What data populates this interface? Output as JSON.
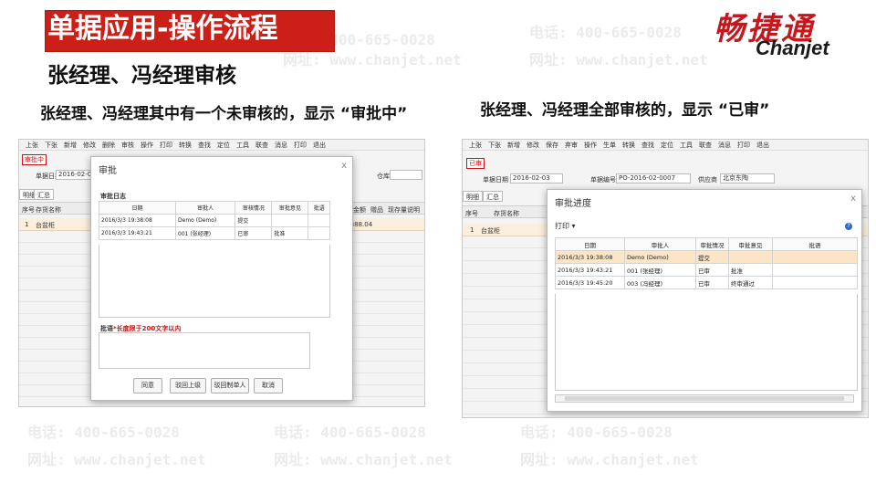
{
  "header": {
    "title": "单据应用-操作流程",
    "subtitle": "张经理、冯经理审核",
    "logo_cn": "畅捷通",
    "logo_en": "Chanjet"
  },
  "captions": {
    "left": "张经理、冯经理其中有一个未审核的，显示 “审批中”",
    "right": "张经理、冯经理全部审核的，显示 “已审”"
  },
  "watermark": {
    "phone": "电话: 400-665-0028",
    "site": "网址: www.chanjet.net"
  },
  "left_panel": {
    "menu": [
      "上张",
      "下张",
      "新增",
      "修改",
      "删除",
      "审核",
      "操作",
      "打印",
      "转换",
      "查找",
      "定位",
      "工具",
      "联查",
      "消息",
      "打印",
      "退出"
    ],
    "status_tag": "审批中",
    "date_label": "单据日期",
    "date_value": "2016-02-03",
    "warehouse_label": "仓库",
    "tabs": [
      "明细",
      "汇总"
    ],
    "grid_headers": [
      "序号",
      "存货名称",
      "含税金额",
      "赠品",
      "现存量说明"
    ],
    "row": {
      "index": "1",
      "name": "台盆柜",
      "amount": "1,888.04"
    },
    "dialog": {
      "title": "审批",
      "close": "x",
      "section": "审批日志",
      "headers": [
        "日期",
        "审批人",
        "审核情况",
        "审批意见",
        "批语"
      ],
      "rows": [
        {
          "date": "2016/3/3 19:38:08",
          "person": "Demo (Demo)",
          "status": "提交",
          "opinion": "",
          "comment": ""
        },
        {
          "date": "2016/3/3 19:43:21",
          "person": "001 (张经理)",
          "status": "已审",
          "opinion": "批准",
          "comment": ""
        }
      ],
      "comment_label": "批语",
      "comment_hint": "长度限于200文字以内",
      "buttons": [
        "同意",
        "驳回上级",
        "驳回制单人",
        "取消"
      ]
    }
  },
  "right_panel": {
    "menu": [
      "上张",
      "下张",
      "新增",
      "修改",
      "保存",
      "弃审",
      "操作",
      "生单",
      "转换",
      "查找",
      "定位",
      "工具",
      "联查",
      "消息",
      "打印",
      "退出"
    ],
    "status_tag": "已审",
    "date_label": "单据日期",
    "date_value": "2016-02-03",
    "code_label": "单据编号",
    "code_value": "PO-2016-02-0007",
    "supplier_label": "供应商",
    "supplier_value": "北京东陶",
    "tabs": [
      "明细",
      "汇总"
    ],
    "grid_headers": [
      "序号",
      "存货名称"
    ],
    "row": {
      "index": "1",
      "name": "台盆柜"
    },
    "dialog": {
      "title": "审批进度",
      "close": "x",
      "print": "打印",
      "help": "?",
      "headers": [
        "日期",
        "审批人",
        "审批情况",
        "审批意见",
        "批语"
      ],
      "rows": [
        {
          "date": "2016/3/3 19:38:08",
          "person": "Demo (Demo)",
          "status": "提交",
          "opinion": "",
          "comment": ""
        },
        {
          "date": "2016/3/3 19:43:21",
          "person": "001 (张经理)",
          "status": "已审",
          "opinion": "批准",
          "comment": ""
        },
        {
          "date": "2016/3/3 19:45:20",
          "person": "003 (冯经理)",
          "status": "已审",
          "opinion": "终审通过",
          "comment": ""
        }
      ]
    }
  },
  "colors": {
    "title_bg": "#cc1f17",
    "logo_red": "#c8161d",
    "status_red": "#d01010",
    "row_highlight": "#fbe5c5"
  }
}
